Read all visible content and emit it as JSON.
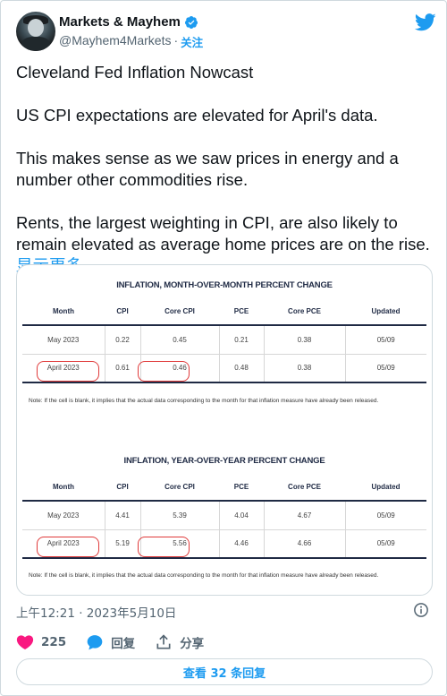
{
  "author": {
    "display_name": "Markets & Mayhem",
    "handle": "@Mayhem4Markets",
    "separator": "·",
    "follow_label": "关注"
  },
  "tweet": {
    "paragraphs": [
      "Cleveland Fed Inflation Nowcast",
      "US CPI expectations are elevated for April's data.",
      "This makes sense as we saw prices in energy and a number other commodities rise.",
      "Rents, the largest weighting in CPI, are also likely to remain elevated as average home prices are on the rise."
    ],
    "show_more": "显示更多"
  },
  "image": {
    "tables": [
      {
        "title": "INFLATION, MONTH-OVER-MONTH PERCENT CHANGE",
        "headers": [
          "Month",
          "CPI",
          "Core CPI",
          "PCE",
          "Core PCE",
          "Updated"
        ],
        "rows": [
          [
            "May 2023",
            "0.22",
            "0.45",
            "0.21",
            "0.38",
            "05/09"
          ],
          [
            "April 2023",
            "0.61",
            "0.46",
            "0.48",
            "0.38",
            "05/09"
          ]
        ],
        "note": "Note: If the cell is blank, it implies that the actual data corresponding to the month for that inflation measure have already been released."
      },
      {
        "title": "INFLATION, YEAR-OVER-YEAR PERCENT CHANGE",
        "headers": [
          "Month",
          "CPI",
          "Core CPI",
          "PCE",
          "Core PCE",
          "Updated"
        ],
        "rows": [
          [
            "May 2023",
            "4.41",
            "5.39",
            "4.04",
            "4.67",
            "05/09"
          ],
          [
            "April 2023",
            "5.19",
            "5.56",
            "4.46",
            "4.66",
            "05/09"
          ]
        ],
        "note": "Note: If the cell is blank, it implies that the actual data corresponding to the month for that inflation measure have already been released."
      }
    ],
    "highlight_color": "#e03a3a"
  },
  "meta": {
    "timestamp": "上午12:21 · 2023年5月10日"
  },
  "actions": {
    "like_count": "225",
    "reply_label": "回复",
    "share_label": "分享"
  },
  "replies_button": "查看 32 条回复",
  "colors": {
    "accent": "#1d9bf0",
    "like": "#f91880",
    "text": "#0f1419",
    "muted": "#536471"
  },
  "icons": [
    "verified-badge-icon",
    "twitter-bird-icon",
    "info-icon",
    "heart-icon",
    "reply-bubble-icon",
    "share-icon"
  ]
}
